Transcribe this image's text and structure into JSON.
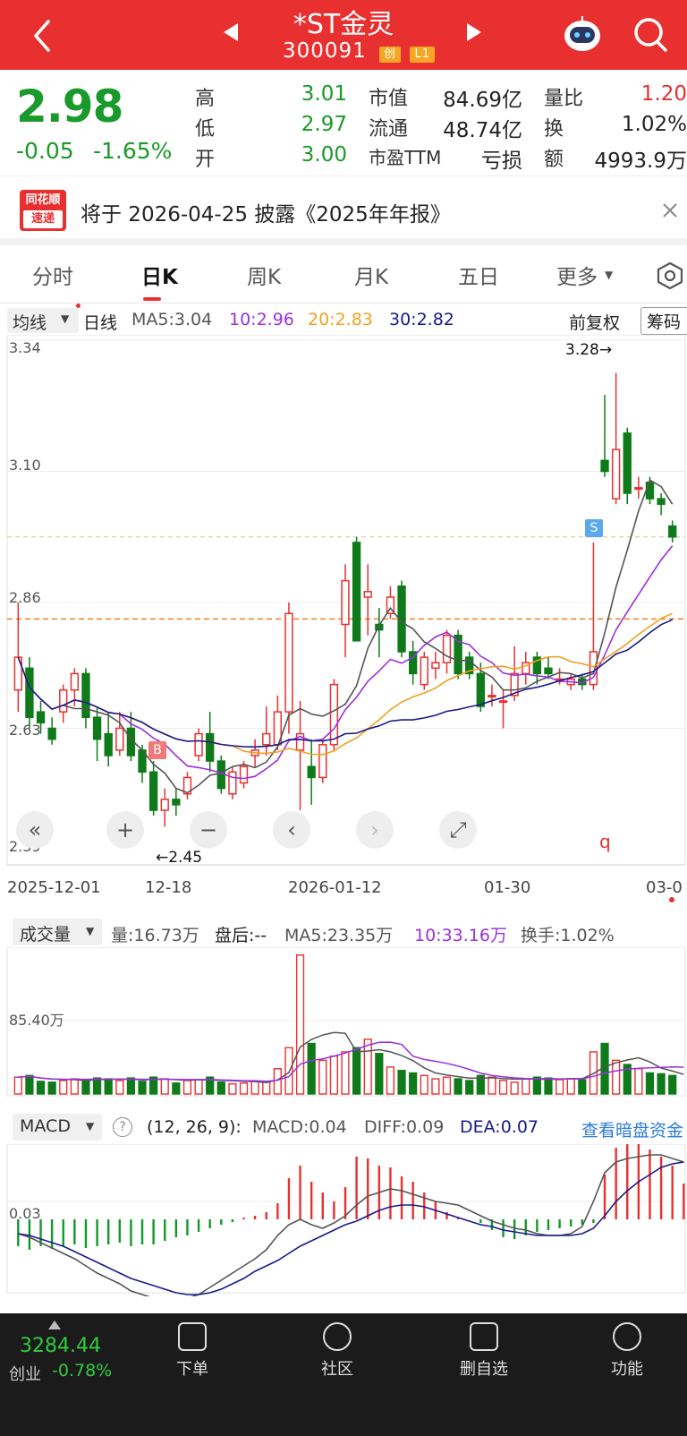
{
  "header": {
    "title": "*ST金灵",
    "code": "300091",
    "tag_chuang": "创",
    "tag_level": "L1"
  },
  "quote": {
    "price": "2.98",
    "change": "-0.05",
    "change_pct": "-1.65%",
    "rows": [
      {
        "l1": "高",
        "v1": "3.01",
        "l2": "市值",
        "v2": "84.69亿",
        "l3": "量比",
        "v3": "1.20"
      },
      {
        "l1": "低",
        "v1": "2.97",
        "l2": "流通",
        "v2": "48.74亿",
        "l3": "换",
        "v3": "1.02%"
      },
      {
        "l1": "开",
        "v1": "3.00",
        "l2": "市盈TTM",
        "v2": "亏损",
        "l3": "额",
        "v3": "4993.9万"
      }
    ]
  },
  "notice": {
    "logo_line1": "同花顺",
    "logo_line2": "速递",
    "text": "将于 2026-04-25 披露《2025年年报》"
  },
  "tabs": [
    "分时",
    "日K",
    "周K",
    "月K",
    "五日",
    "更多"
  ],
  "active_tab": "日K",
  "kline": {
    "indicator_select": "均线",
    "period": "日线",
    "ma5": "MA5:3.04",
    "ma10": "10:2.96",
    "ma20": "20:2.83",
    "ma30": "30:2.82",
    "adjust": "前复权",
    "chips": "筹码",
    "y_labels": [
      "3.34",
      "3.10",
      "2.86",
      "2.63",
      "2.39"
    ],
    "high_marker": "3.28→",
    "low_marker": "←2.45",
    "buy_mark": "B",
    "sell_mark": "S",
    "q_mark": "q",
    "dates": [
      "2025-12-01",
      "12-18",
      "2026-01-12",
      "01-30",
      "03-0"
    ],
    "colors": {
      "up": "#e93030",
      "down": "#0f7a19",
      "ma5": "#555555",
      "ma10": "#9b30e0",
      "ma20": "#f0a020",
      "ma30": "#1a1a8a"
    }
  },
  "controls": [
    "«",
    "+",
    "−",
    "‹",
    "›",
    "⤢"
  ],
  "volume": {
    "select": "成交量",
    "vol": "量:16.73万",
    "after": "盘后:--",
    "ma5": "MA5:23.35万",
    "ma10": "10:33.16万",
    "turnover": "换手:1.02%",
    "y_label": "85.40万"
  },
  "macd": {
    "select": "MACD",
    "params": "(12, 26, 9):",
    "macd": "MACD:0.04",
    "diff": "DIFF:0.09",
    "dea": "DEA:0.07",
    "link": "查看暗盘资金",
    "y_label": "0.03"
  },
  "bottom": {
    "index_value": "3284.44",
    "index_name": "创业",
    "index_change": "-0.78%",
    "items": [
      "下单",
      "社区",
      "删自选",
      "功能"
    ]
  },
  "chart_data": {
    "type": "candlestick",
    "title": "*ST金灵 日K",
    "ylim": [
      2.39,
      3.34
    ],
    "candles": [
      {
        "o": 2.7,
        "c": 2.76,
        "h": 2.86,
        "l": 2.66
      },
      {
        "o": 2.74,
        "c": 2.65,
        "h": 2.76,
        "l": 2.63
      },
      {
        "o": 2.66,
        "c": 2.64,
        "h": 2.68,
        "l": 2.62
      },
      {
        "o": 2.63,
        "c": 2.61,
        "h": 2.65,
        "l": 2.6
      },
      {
        "o": 2.66,
        "c": 2.7,
        "h": 2.71,
        "l": 2.64
      },
      {
        "o": 2.7,
        "c": 2.73,
        "h": 2.74,
        "l": 2.67
      },
      {
        "o": 2.73,
        "c": 2.65,
        "h": 2.74,
        "l": 2.63
      },
      {
        "o": 2.65,
        "c": 2.61,
        "h": 2.67,
        "l": 2.57
      },
      {
        "o": 2.62,
        "c": 2.58,
        "h": 2.66,
        "l": 2.56
      },
      {
        "o": 2.59,
        "c": 2.63,
        "h": 2.66,
        "l": 2.58
      },
      {
        "o": 2.63,
        "c": 2.58,
        "h": 2.66,
        "l": 2.57
      },
      {
        "o": 2.59,
        "c": 2.55,
        "h": 2.6,
        "l": 2.53
      },
      {
        "o": 2.55,
        "c": 2.48,
        "h": 2.57,
        "l": 2.47
      },
      {
        "o": 2.48,
        "c": 2.5,
        "h": 2.52,
        "l": 2.45
      },
      {
        "o": 2.5,
        "c": 2.49,
        "h": 2.52,
        "l": 2.47
      },
      {
        "o": 2.51,
        "c": 2.54,
        "h": 2.55,
        "l": 2.5
      },
      {
        "o": 2.58,
        "c": 2.62,
        "h": 2.63,
        "l": 2.57
      },
      {
        "o": 2.62,
        "c": 2.57,
        "h": 2.66,
        "l": 2.55
      },
      {
        "o": 2.57,
        "c": 2.52,
        "h": 2.58,
        "l": 2.51
      },
      {
        "o": 2.51,
        "c": 2.55,
        "h": 2.56,
        "l": 2.5
      },
      {
        "o": 2.53,
        "c": 2.56,
        "h": 2.57,
        "l": 2.52
      },
      {
        "o": 2.58,
        "c": 2.59,
        "h": 2.61,
        "l": 2.56
      },
      {
        "o": 2.6,
        "c": 2.62,
        "h": 2.67,
        "l": 2.58
      },
      {
        "o": 2.6,
        "c": 2.66,
        "h": 2.69,
        "l": 2.59
      },
      {
        "o": 2.66,
        "c": 2.84,
        "h": 2.86,
        "l": 2.62
      },
      {
        "o": 2.59,
        "c": 2.62,
        "h": 2.68,
        "l": 2.48
      },
      {
        "o": 2.56,
        "c": 2.54,
        "h": 2.61,
        "l": 2.49
      },
      {
        "o": 2.54,
        "c": 2.6,
        "h": 2.61,
        "l": 2.53
      },
      {
        "o": 2.6,
        "c": 2.71,
        "h": 2.72,
        "l": 2.59
      },
      {
        "o": 2.82,
        "c": 2.9,
        "h": 2.93,
        "l": 2.76
      },
      {
        "o": 2.97,
        "c": 2.79,
        "h": 2.98,
        "l": 2.79
      },
      {
        "o": 2.87,
        "c": 2.88,
        "h": 2.93,
        "l": 2.8
      },
      {
        "o": 2.82,
        "c": 2.81,
        "h": 2.85,
        "l": 2.76
      },
      {
        "o": 2.84,
        "c": 2.87,
        "h": 2.89,
        "l": 2.83
      },
      {
        "o": 2.89,
        "c": 2.77,
        "h": 2.9,
        "l": 2.76
      },
      {
        "o": 2.77,
        "c": 2.73,
        "h": 2.79,
        "l": 2.71
      },
      {
        "o": 2.71,
        "c": 2.76,
        "h": 2.77,
        "l": 2.7
      },
      {
        "o": 2.74,
        "c": 2.75,
        "h": 2.77,
        "l": 2.72
      },
      {
        "o": 2.75,
        "c": 2.8,
        "h": 2.81,
        "l": 2.73
      },
      {
        "o": 2.8,
        "c": 2.73,
        "h": 2.81,
        "l": 2.72
      },
      {
        "o": 2.76,
        "c": 2.73,
        "h": 2.77,
        "l": 2.72
      },
      {
        "o": 2.73,
        "c": 2.67,
        "h": 2.75,
        "l": 2.66
      },
      {
        "o": 2.69,
        "c": 2.69,
        "h": 2.71,
        "l": 2.67
      },
      {
        "o": 2.68,
        "c": 2.68,
        "h": 2.7,
        "l": 2.63
      },
      {
        "o": 2.69,
        "c": 2.73,
        "h": 2.78,
        "l": 2.68
      },
      {
        "o": 2.73,
        "c": 2.75,
        "h": 2.77,
        "l": 2.71
      },
      {
        "o": 2.76,
        "c": 2.73,
        "h": 2.77,
        "l": 2.71
      },
      {
        "o": 2.74,
        "c": 2.73,
        "h": 2.76,
        "l": 2.72
      },
      {
        "o": 2.72,
        "c": 2.72,
        "h": 2.74,
        "l": 2.71
      },
      {
        "o": 2.71,
        "c": 2.72,
        "h": 2.73,
        "l": 2.7
      },
      {
        "o": 2.72,
        "c": 2.71,
        "h": 2.73,
        "l": 2.7
      },
      {
        "o": 2.71,
        "c": 2.77,
        "h": 2.97,
        "l": 2.7
      },
      {
        "o": 3.12,
        "c": 3.1,
        "h": 3.24,
        "l": 3.09
      },
      {
        "o": 3.05,
        "c": 3.14,
        "h": 3.28,
        "l": 3.04
      },
      {
        "o": 3.17,
        "c": 3.06,
        "h": 3.18,
        "l": 3.04
      },
      {
        "o": 3.07,
        "c": 3.07,
        "h": 3.09,
        "l": 3.05
      },
      {
        "o": 3.08,
        "c": 3.05,
        "h": 3.09,
        "l": 3.04
      },
      {
        "o": 3.05,
        "c": 3.04,
        "h": 3.06,
        "l": 3.02
      },
      {
        "o": 3.0,
        "c": 2.98,
        "h": 3.01,
        "l": 2.97
      }
    ]
  }
}
